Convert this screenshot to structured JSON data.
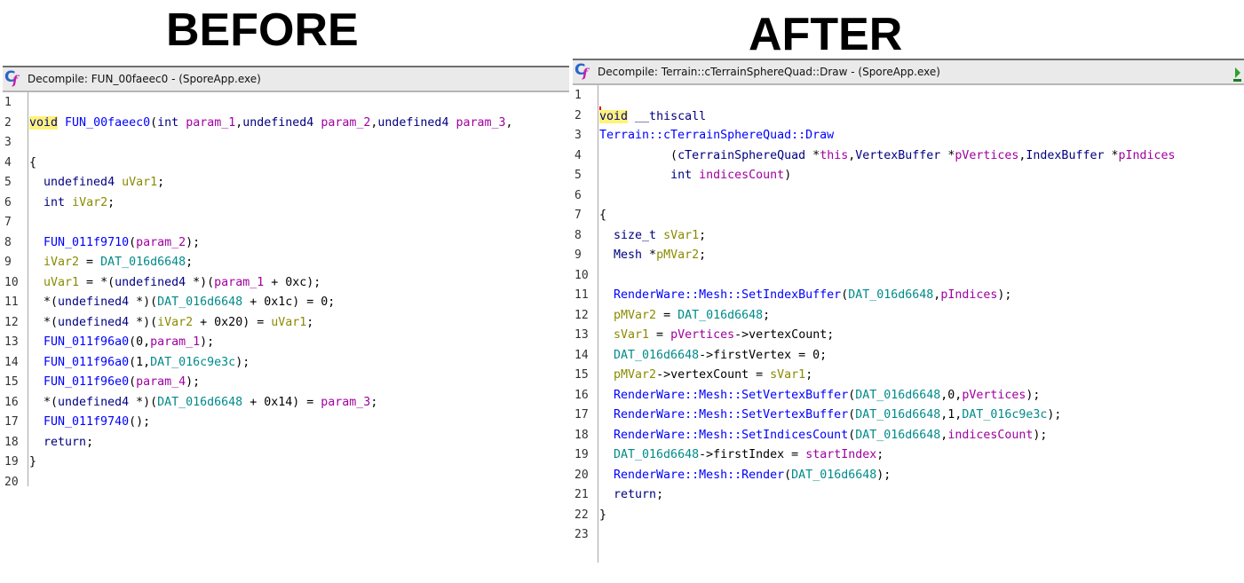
{
  "headings": {
    "before": "BEFORE",
    "after": "AFTER"
  },
  "before": {
    "window_title": "Decompile: FUN_00faeec0 -  (SporeApp.exe)",
    "lines": [
      {
        "n": "1",
        "t": []
      },
      {
        "n": "2",
        "t": [
          [
            "void",
            "kw hl"
          ],
          [
            " ",
            ""
          ],
          [
            "FUN_00faeec0",
            "fn"
          ],
          [
            "(",
            ""
          ],
          [
            "int",
            "kw"
          ],
          [
            " ",
            ""
          ],
          [
            "param_1",
            "pr"
          ],
          [
            ",",
            ""
          ],
          [
            "undefined4",
            "kw"
          ],
          [
            " ",
            ""
          ],
          [
            "param_2",
            "pr"
          ],
          [
            ",",
            ""
          ],
          [
            "undefined4",
            "kw"
          ],
          [
            " ",
            ""
          ],
          [
            "param_3",
            "pr"
          ],
          [
            ",",
            ""
          ]
        ]
      },
      {
        "n": "3",
        "t": []
      },
      {
        "n": "4",
        "t": [
          [
            "{",
            ""
          ]
        ]
      },
      {
        "n": "5",
        "t": [
          [
            "  ",
            ""
          ],
          [
            "undefined4",
            "kw"
          ],
          [
            " ",
            ""
          ],
          [
            "uVar1",
            "lv"
          ],
          [
            ";",
            ""
          ]
        ]
      },
      {
        "n": "6",
        "t": [
          [
            "  ",
            ""
          ],
          [
            "int",
            "kw"
          ],
          [
            " ",
            ""
          ],
          [
            "iVar2",
            "lv"
          ],
          [
            ";",
            ""
          ]
        ]
      },
      {
        "n": "7",
        "t": []
      },
      {
        "n": "8",
        "t": [
          [
            "  ",
            ""
          ],
          [
            "FUN_011f9710",
            "fn"
          ],
          [
            "(",
            ""
          ],
          [
            "param_2",
            "pr"
          ],
          [
            ");",
            ""
          ]
        ]
      },
      {
        "n": "9",
        "t": [
          [
            "  ",
            ""
          ],
          [
            "iVar2",
            "lv"
          ],
          [
            " = ",
            ""
          ],
          [
            "DAT_016d6648",
            "gl"
          ],
          [
            ";",
            ""
          ]
        ]
      },
      {
        "n": "10",
        "t": [
          [
            "  ",
            ""
          ],
          [
            "uVar1",
            "lv"
          ],
          [
            " = *(",
            ""
          ],
          [
            "undefined4",
            "kw"
          ],
          [
            " *)(",
            ""
          ],
          [
            "param_1",
            "pr"
          ],
          [
            " + 0xc);",
            ""
          ]
        ]
      },
      {
        "n": "11",
        "t": [
          [
            "  *(",
            ""
          ],
          [
            "undefined4",
            "kw"
          ],
          [
            " *)(",
            ""
          ],
          [
            "DAT_016d6648",
            "gl"
          ],
          [
            " + 0x1c) = 0;",
            ""
          ]
        ]
      },
      {
        "n": "12",
        "t": [
          [
            "  *(",
            ""
          ],
          [
            "undefined4",
            "kw"
          ],
          [
            " *)(",
            ""
          ],
          [
            "iVar2",
            "lv"
          ],
          [
            " + 0x20) = ",
            ""
          ],
          [
            "uVar1",
            "lv"
          ],
          [
            ";",
            ""
          ]
        ]
      },
      {
        "n": "13",
        "t": [
          [
            "  ",
            ""
          ],
          [
            "FUN_011f96a0",
            "fn"
          ],
          [
            "(0,",
            ""
          ],
          [
            "param_1",
            "pr"
          ],
          [
            ");",
            ""
          ]
        ]
      },
      {
        "n": "14",
        "t": [
          [
            "  ",
            ""
          ],
          [
            "FUN_011f96a0",
            "fn"
          ],
          [
            "(1,",
            ""
          ],
          [
            "DAT_016c9e3c",
            "gl"
          ],
          [
            ");",
            ""
          ]
        ]
      },
      {
        "n": "15",
        "t": [
          [
            "  ",
            ""
          ],
          [
            "FUN_011f96e0",
            "fn"
          ],
          [
            "(",
            ""
          ],
          [
            "param_4",
            "pr"
          ],
          [
            ");",
            ""
          ]
        ]
      },
      {
        "n": "16",
        "t": [
          [
            "  *(",
            ""
          ],
          [
            "undefined4",
            "kw"
          ],
          [
            " *)(",
            ""
          ],
          [
            "DAT_016d6648",
            "gl"
          ],
          [
            " + 0x14) = ",
            ""
          ],
          [
            "param_3",
            "pr"
          ],
          [
            ";",
            ""
          ]
        ]
      },
      {
        "n": "17",
        "t": [
          [
            "  ",
            ""
          ],
          [
            "FUN_011f9740",
            "fn"
          ],
          [
            "();",
            ""
          ]
        ]
      },
      {
        "n": "18",
        "t": [
          [
            "  ",
            ""
          ],
          [
            "return",
            "kw"
          ],
          [
            ";",
            ""
          ]
        ]
      },
      {
        "n": "19",
        "t": [
          [
            "}",
            ""
          ]
        ]
      },
      {
        "n": "20",
        "t": []
      }
    ]
  },
  "after": {
    "window_title": "Decompile: Terrain::cTerrainSphereQuad::Draw -  (SporeApp.exe)",
    "lines": [
      {
        "n": "1",
        "t": []
      },
      {
        "n": "2",
        "cursor": true,
        "t": [
          [
            "void",
            "kw hl"
          ],
          [
            " ",
            ""
          ],
          [
            "__thiscall",
            "kw"
          ]
        ]
      },
      {
        "n": "3",
        "t": [
          [
            "Terrain::cTerrainSphereQuad::Draw",
            "fn"
          ]
        ]
      },
      {
        "n": "4",
        "t": [
          [
            "          (",
            ""
          ],
          [
            "cTerrainSphereQuad",
            "kw"
          ],
          [
            " *",
            ""
          ],
          [
            "this",
            "pr"
          ],
          [
            ",",
            ""
          ],
          [
            "VertexBuffer",
            "kw"
          ],
          [
            " *",
            ""
          ],
          [
            "pVertices",
            "pr"
          ],
          [
            ",",
            ""
          ],
          [
            "IndexBuffer",
            "kw"
          ],
          [
            " *",
            ""
          ],
          [
            "pIndices",
            "pr"
          ]
        ]
      },
      {
        "n": "5",
        "t": [
          [
            "          ",
            ""
          ],
          [
            "int",
            "kw"
          ],
          [
            " ",
            ""
          ],
          [
            "indicesCount",
            "pr"
          ],
          [
            ")",
            ""
          ]
        ]
      },
      {
        "n": "6",
        "t": []
      },
      {
        "n": "7",
        "t": [
          [
            "{",
            ""
          ]
        ]
      },
      {
        "n": "8",
        "t": [
          [
            "  ",
            ""
          ],
          [
            "size_t",
            "kw"
          ],
          [
            " ",
            ""
          ],
          [
            "sVar1",
            "lv"
          ],
          [
            ";",
            ""
          ]
        ]
      },
      {
        "n": "9",
        "t": [
          [
            "  ",
            ""
          ],
          [
            "Mesh",
            "kw"
          ],
          [
            " *",
            ""
          ],
          [
            "pMVar2",
            "lv"
          ],
          [
            ";",
            ""
          ]
        ]
      },
      {
        "n": "10",
        "t": []
      },
      {
        "n": "11",
        "t": [
          [
            "  ",
            ""
          ],
          [
            "RenderWare::Mesh::SetIndexBuffer",
            "fn"
          ],
          [
            "(",
            ""
          ],
          [
            "DAT_016d6648",
            "gl"
          ],
          [
            ",",
            ""
          ],
          [
            "pIndices",
            "pr"
          ],
          [
            ");",
            ""
          ]
        ]
      },
      {
        "n": "12",
        "t": [
          [
            "  ",
            ""
          ],
          [
            "pMVar2",
            "lv"
          ],
          [
            " = ",
            ""
          ],
          [
            "DAT_016d6648",
            "gl"
          ],
          [
            ";",
            ""
          ]
        ]
      },
      {
        "n": "13",
        "t": [
          [
            "  ",
            ""
          ],
          [
            "sVar1",
            "lv"
          ],
          [
            " = ",
            ""
          ],
          [
            "pVertices",
            "pr"
          ],
          [
            "->vertexCount;",
            ""
          ]
        ]
      },
      {
        "n": "14",
        "t": [
          [
            "  ",
            ""
          ],
          [
            "DAT_016d6648",
            "gl"
          ],
          [
            "->firstVertex = 0;",
            ""
          ]
        ]
      },
      {
        "n": "15",
        "t": [
          [
            "  ",
            ""
          ],
          [
            "pMVar2",
            "lv"
          ],
          [
            "->vertexCount = ",
            ""
          ],
          [
            "sVar1",
            "lv"
          ],
          [
            ";",
            ""
          ]
        ]
      },
      {
        "n": "16",
        "t": [
          [
            "  ",
            ""
          ],
          [
            "RenderWare::Mesh::SetVertexBuffer",
            "fn"
          ],
          [
            "(",
            ""
          ],
          [
            "DAT_016d6648",
            "gl"
          ],
          [
            ",0,",
            ""
          ],
          [
            "pVertices",
            "pr"
          ],
          [
            ");",
            ""
          ]
        ]
      },
      {
        "n": "17",
        "t": [
          [
            "  ",
            ""
          ],
          [
            "RenderWare::Mesh::SetVertexBuffer",
            "fn"
          ],
          [
            "(",
            ""
          ],
          [
            "DAT_016d6648",
            "gl"
          ],
          [
            ",1,",
            ""
          ],
          [
            "DAT_016c9e3c",
            "gl"
          ],
          [
            ");",
            ""
          ]
        ]
      },
      {
        "n": "18",
        "t": [
          [
            "  ",
            ""
          ],
          [
            "RenderWare::Mesh::SetIndicesCount",
            "fn"
          ],
          [
            "(",
            ""
          ],
          [
            "DAT_016d6648",
            "gl"
          ],
          [
            ",",
            ""
          ],
          [
            "indicesCount",
            "pr"
          ],
          [
            ");",
            ""
          ]
        ]
      },
      {
        "n": "19",
        "t": [
          [
            "  ",
            ""
          ],
          [
            "DAT_016d6648",
            "gl"
          ],
          [
            "->firstIndex = ",
            ""
          ],
          [
            "startIndex",
            "pr"
          ],
          [
            ";",
            ""
          ]
        ]
      },
      {
        "n": "20",
        "t": [
          [
            "  ",
            ""
          ],
          [
            "RenderWare::Mesh::Render",
            "fn"
          ],
          [
            "(",
            ""
          ],
          [
            "DAT_016d6648",
            "gl"
          ],
          [
            ");",
            ""
          ]
        ]
      },
      {
        "n": "21",
        "t": [
          [
            "  ",
            ""
          ],
          [
            "return",
            "kw"
          ],
          [
            ";",
            ""
          ]
        ]
      },
      {
        "n": "22",
        "t": [
          [
            "}",
            ""
          ]
        ]
      },
      {
        "n": "23",
        "t": []
      }
    ]
  }
}
